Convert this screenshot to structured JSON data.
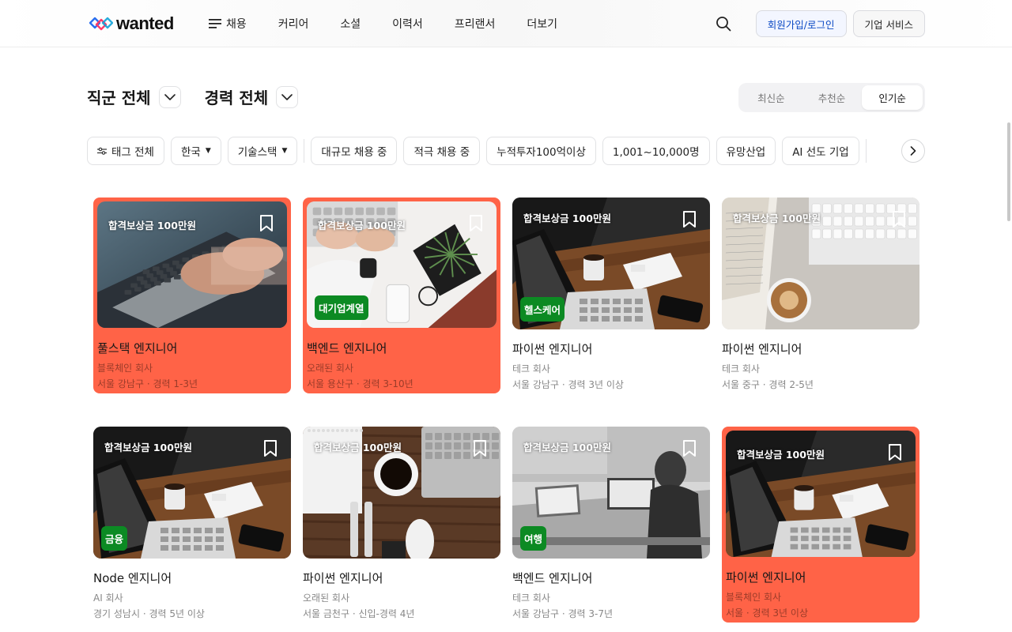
{
  "header": {
    "logo_text": "wanted",
    "nav": [
      "채용",
      "커리어",
      "소셜",
      "이력서",
      "프리랜서",
      "더보기"
    ],
    "login_label": "회원가입/로그인",
    "biz_label": "기업 서비스"
  },
  "filters": {
    "job_select": "직군 전체",
    "career_select": "경력 전체",
    "sort_options": [
      "최신순",
      "추천순",
      "인기순"
    ],
    "sort_active": "인기순",
    "tag_all": "태그 전체",
    "country": "한국",
    "tech_stack": "기술스택",
    "chips": [
      "대규모 채용 중",
      "적극 채용 중",
      "누적투자100억이상",
      "1,001~10,000명",
      "유망산업",
      "AI 선도 기업"
    ]
  },
  "jobs": [
    {
      "reward": "합격보상금 100만원",
      "title": "풀스택 엔지니어",
      "company": "블록체인 회사",
      "location": "서울 강남구 · 경력 1-3년",
      "badge": "",
      "highlight": true,
      "image": "laptop-typing"
    },
    {
      "reward": "합격보상금 100만원",
      "title": "백엔드 엔지니어",
      "company": "오래된 회사",
      "location": "서울 용산구 · 경력 3-10년",
      "badge": "대기업계열",
      "highlight": true,
      "image": "desk-plant"
    },
    {
      "reward": "합격보상금 100만원",
      "title": "파이썬 엔지니어",
      "company": "테크 회사",
      "location": "서울 강남구 · 경력 3년 이상",
      "badge": "헬스케어",
      "highlight": false,
      "image": "desk-coffee"
    },
    {
      "reward": "합격보상금 100만원",
      "title": "파이썬 엔지니어",
      "company": "테크 회사",
      "location": "서울 중구 · 경력 2-5년",
      "badge": "",
      "highlight": false,
      "image": "keyboard-latte"
    },
    {
      "reward": "합격보상금 100만원",
      "title": "Node 엔지니어",
      "company": "AI 회사",
      "location": "경기 성남시 · 경력 5년 이상",
      "badge": "금융",
      "highlight": false,
      "image": "desk-coffee"
    },
    {
      "reward": "합격보상금 100만원",
      "title": "파이썬 엔지니어",
      "company": "오래된 회사",
      "location": "서울 금천구 · 신입-경력 4년",
      "badge": "",
      "highlight": false,
      "image": "desk-topdown"
    },
    {
      "reward": "합격보상금 100만원",
      "title": "백엔드 엔지니어",
      "company": "테크 회사",
      "location": "서울 강남구 · 경력 3-7년",
      "badge": "여행",
      "highlight": false,
      "image": "office-bw"
    },
    {
      "reward": "합격보상금 100만원",
      "title": "파이썬 엔지니어",
      "company": "블록체인 회사",
      "location": "서울 · 경력 3년 이상",
      "badge": "",
      "highlight": true,
      "image": "desk-coffee"
    }
  ],
  "colors": {
    "highlight": "#ff6347",
    "badge": "#0c8a23",
    "link": "#0b49c4"
  }
}
